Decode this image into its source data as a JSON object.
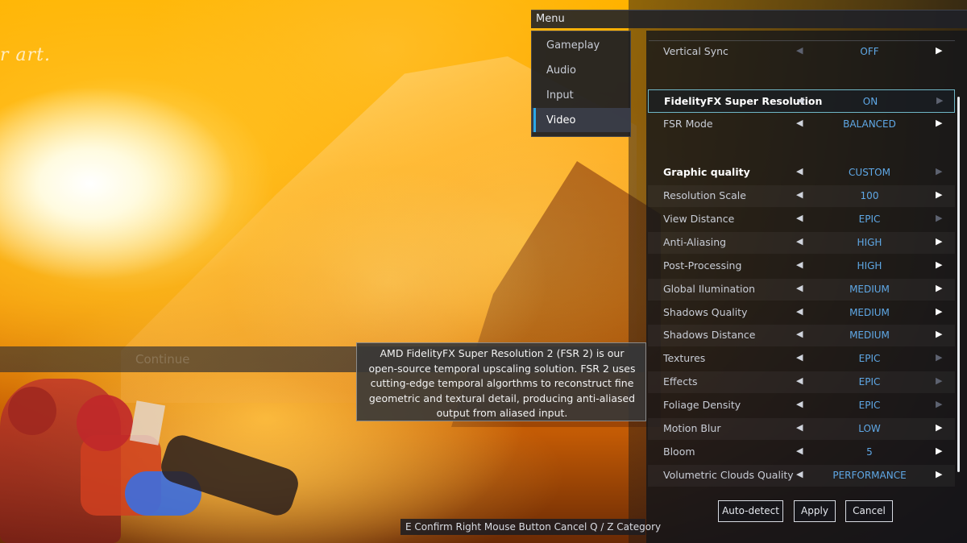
{
  "background": {
    "sketch_text": "r art.",
    "continue_label": "Continue"
  },
  "menu": {
    "title": "Menu",
    "categories": [
      {
        "label": "Gameplay",
        "active": false
      },
      {
        "label": "Audio",
        "active": false
      },
      {
        "label": "Input",
        "active": false
      },
      {
        "label": "Video",
        "active": true
      }
    ]
  },
  "settings": [
    {
      "label": "Vertical Sync",
      "value": "OFF",
      "left_enabled": false,
      "right_enabled": true,
      "bold": false,
      "selected": false
    },
    {
      "label": "FidelityFX Super Resolution",
      "value": "ON",
      "left_enabled": true,
      "right_enabled": false,
      "bold": true,
      "selected": true
    },
    {
      "label": "FSR Mode",
      "value": "BALANCED",
      "left_enabled": true,
      "right_enabled": true,
      "bold": false,
      "selected": false
    },
    {
      "label": "Graphic quality",
      "value": "CUSTOM",
      "left_enabled": true,
      "right_enabled": false,
      "bold": true,
      "selected": false
    },
    {
      "label": "Resolution Scale",
      "value": "100",
      "left_enabled": true,
      "right_enabled": true,
      "bold": false,
      "selected": false
    },
    {
      "label": "View Distance",
      "value": "EPIC",
      "left_enabled": true,
      "right_enabled": false,
      "bold": false,
      "selected": false
    },
    {
      "label": "Anti-Aliasing",
      "value": "HIGH",
      "left_enabled": true,
      "right_enabled": true,
      "bold": false,
      "selected": false
    },
    {
      "label": "Post-Processing",
      "value": "HIGH",
      "left_enabled": true,
      "right_enabled": true,
      "bold": false,
      "selected": false
    },
    {
      "label": "Global Ilumination",
      "value": "MEDIUM",
      "left_enabled": true,
      "right_enabled": true,
      "bold": false,
      "selected": false
    },
    {
      "label": "Shadows Quality",
      "value": "MEDIUM",
      "left_enabled": true,
      "right_enabled": true,
      "bold": false,
      "selected": false
    },
    {
      "label": "Shadows Distance",
      "value": "MEDIUM",
      "left_enabled": true,
      "right_enabled": true,
      "bold": false,
      "selected": false
    },
    {
      "label": "Textures",
      "value": "EPIC",
      "left_enabled": true,
      "right_enabled": false,
      "bold": false,
      "selected": false
    },
    {
      "label": "Effects",
      "value": "EPIC",
      "left_enabled": true,
      "right_enabled": false,
      "bold": false,
      "selected": false
    },
    {
      "label": "Foliage Density",
      "value": "EPIC",
      "left_enabled": true,
      "right_enabled": false,
      "bold": false,
      "selected": false
    },
    {
      "label": "Motion Blur",
      "value": "LOW",
      "left_enabled": true,
      "right_enabled": true,
      "bold": false,
      "selected": false
    },
    {
      "label": "Bloom",
      "value": "5",
      "left_enabled": true,
      "right_enabled": true,
      "bold": false,
      "selected": false
    },
    {
      "label": "Volumetric Clouds Quality",
      "value": "PERFORMANCE",
      "left_enabled": true,
      "right_enabled": true,
      "bold": false,
      "selected": false
    }
  ],
  "arrows": {
    "left": "◀",
    "right": "▶"
  },
  "buttons": {
    "auto_detect": "Auto-detect",
    "apply": "Apply",
    "cancel": "Cancel"
  },
  "tooltip": {
    "text": "AMD FidelityFX Super Resolution 2 (FSR 2) is our open-source temporal upscaling solution. FSR 2 uses cutting-edge temporal algorthms to reconstruct fine geometric and textural detail, producing anti-aliased output from aliased input."
  },
  "hints": {
    "text": "E Confirm Right Mouse Button Cancel Q / Z Category"
  },
  "colors": {
    "accent": "#2aa7e8",
    "value_text": "#5fa8e6",
    "selected_border": "#6fb6c6",
    "panel_bg": "#12141a"
  }
}
